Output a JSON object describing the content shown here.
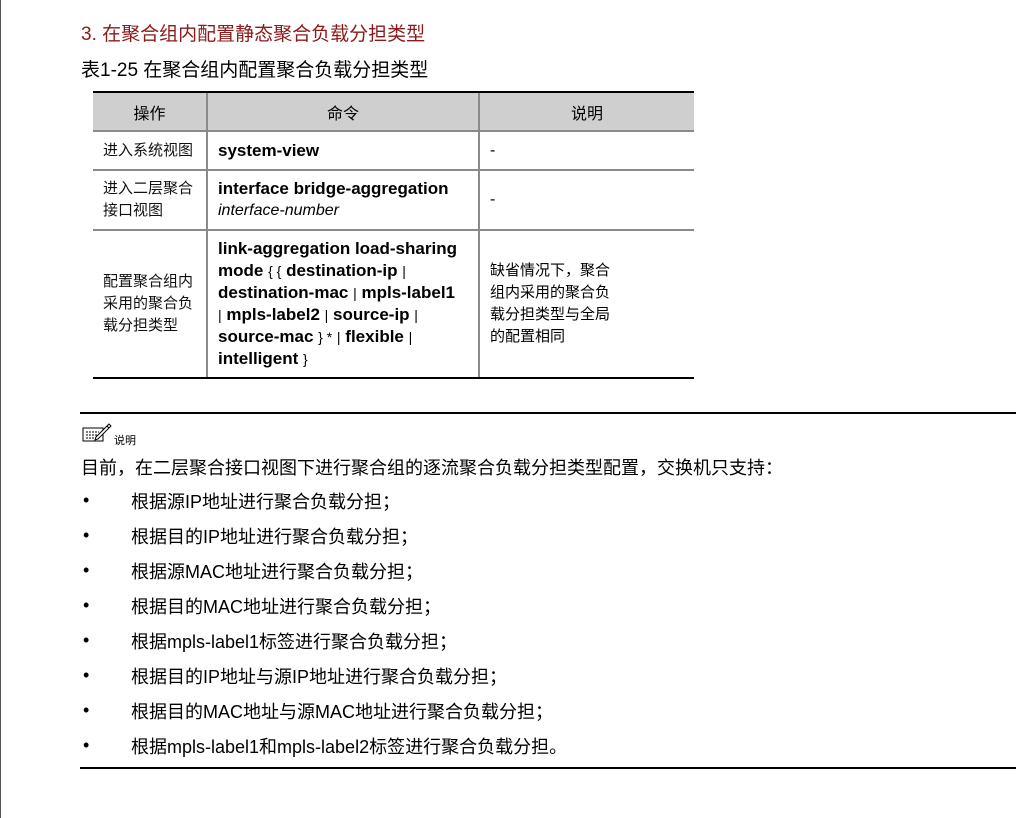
{
  "heading": "3. 在聚合组内配置静态聚合负载分担类型",
  "table": {
    "caption": "表1-25 在聚合组内配置聚合负载分担类型",
    "headers": [
      "操作",
      "命令",
      "说明"
    ],
    "rows": [
      {
        "op": "进入系统视图",
        "cmd_bold": "system-view",
        "desc": "-"
      },
      {
        "op_lines": [
          "进入二层聚合",
          "接口视图"
        ],
        "cmd_bold": "interface bridge-aggregation",
        "cmd_italic": "interface-number",
        "desc": "-"
      },
      {
        "op_lines": [
          "配置聚合组内",
          "采用的聚合负",
          "载分担类型"
        ],
        "cmd_parts": {
          "l1": "link-aggregation load-sharing",
          "mode": "mode",
          "brace_open": "{ {",
          "destination_ip": "destination-ip",
          "pipe": "|",
          "destination_mac": "destination-mac",
          "mpls_label1": "mpls-label1",
          "mpls_label2": "mpls-label2",
          "source_ip": "source-ip",
          "source_mac": "source-mac",
          "brace_close_star": "} *",
          "flexible": "flexible",
          "intelligent": "intelligent",
          "brace_close": "}"
        },
        "desc_lines": [
          "缺省情况下，聚合",
          "组内采用的聚合负",
          "载分担类型与全局",
          "的配置相同"
        ]
      }
    ]
  },
  "note": {
    "label": "说明",
    "icon": "note-pencil-icon",
    "intro": "目前，在二层聚合接口视图下进行聚合组的逐流聚合负载分担类型配置，交换机只支持：",
    "bullet_symbol": "•",
    "items": [
      "根据源IP地址进行聚合负载分担；",
      "根据目的IP地址进行聚合负载分担；",
      "根据源MAC地址进行聚合负载分担；",
      "根据目的MAC地址进行聚合负载分担；",
      "根据mpls-label1标签进行聚合负载分担；",
      "根据目的IP地址与源IP地址进行聚合负载分担；",
      "根据目的MAC地址与源MAC地址进行聚合负载分担；",
      "根据mpls-label1和mpls-label2标签进行聚合负载分担。"
    ]
  },
  "colors": {
    "heading": "#8b1a1a",
    "table_header_bg": "#cfcfcf"
  }
}
